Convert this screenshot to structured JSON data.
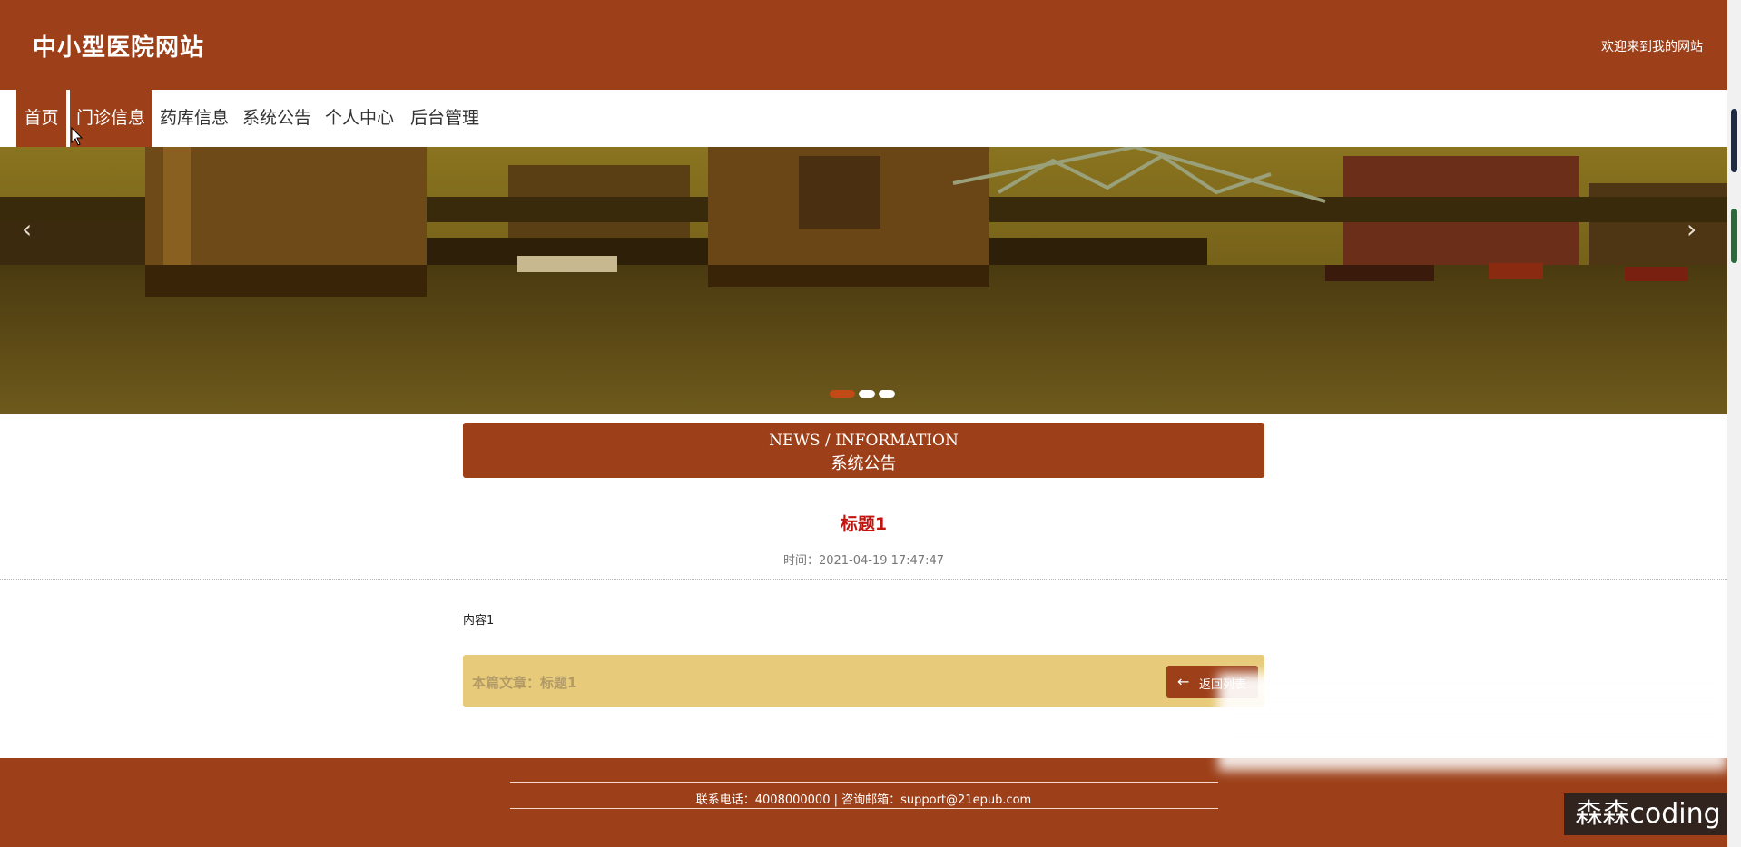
{
  "header": {
    "site_title": "中小型医院网站",
    "welcome": "欢迎来到我的网站"
  },
  "nav": {
    "items": [
      {
        "label": "首页",
        "active": true
      },
      {
        "label": "门诊信息",
        "active": true
      },
      {
        "label": "药库信息",
        "active": false
      },
      {
        "label": "系统公告",
        "active": false
      },
      {
        "label": "个人中心",
        "active": false
      },
      {
        "label": "后台管理",
        "active": false
      }
    ]
  },
  "banner": {
    "prev_icon": "chevron-left-icon",
    "next_icon": "chevron-right-icon",
    "slide_count": 3,
    "active_slide": 1
  },
  "section": {
    "title_en": "NEWS / INFORMATION",
    "title_cn": "系统公告"
  },
  "article": {
    "title": "标题1",
    "time": "时间：2021-04-19 17:47:47",
    "content": "内容1",
    "bar_text": "本篇文章：标题1",
    "back_label": "返回列表",
    "back_icon": "arrow-left-icon"
  },
  "footer": {
    "contact": "联系电话：4008000000 | 咨询邮箱：support@21epub.com"
  },
  "watermark": "森森coding",
  "colors": {
    "brand": "#9d401a",
    "accent_bar": "#e8cb7a",
    "title_red": "#c0150f",
    "active_dot": "#c24a16"
  }
}
